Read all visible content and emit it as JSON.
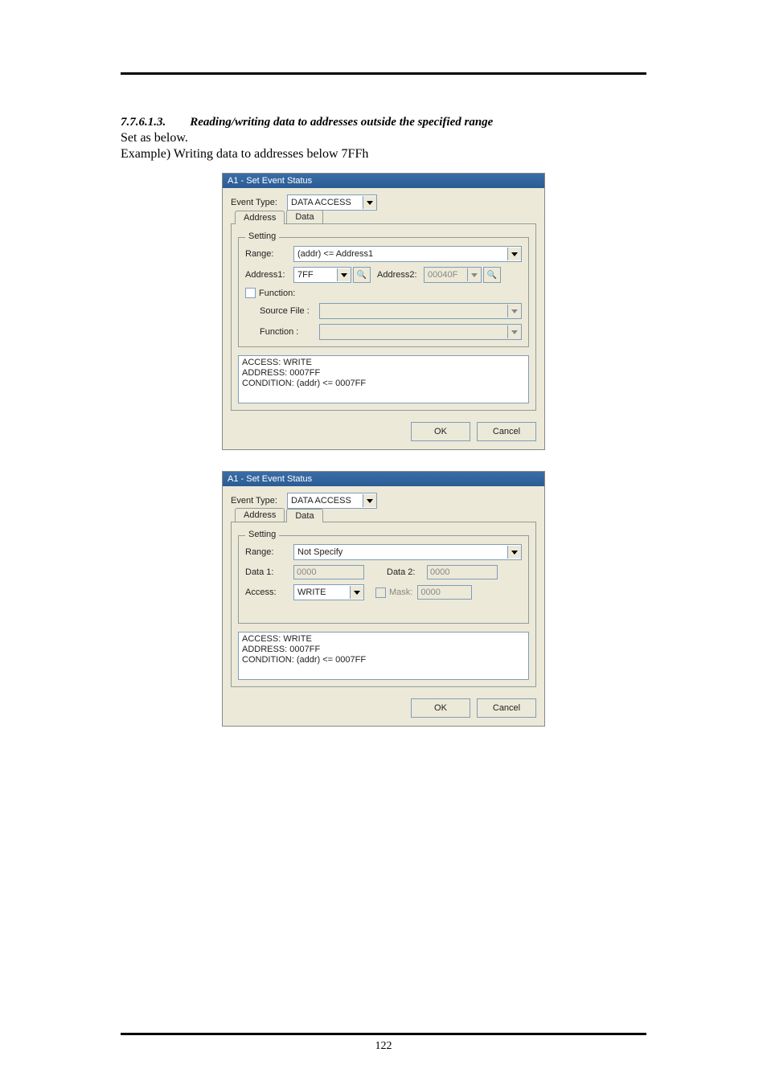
{
  "section": {
    "number": "7.7.6.1.3.",
    "title": "Reading/writing data to addresses outside the specified range"
  },
  "intro_line1": "Set as below.",
  "intro_line2": "Example) Writing data to addresses below 7FFh",
  "dlg1": {
    "title": "A1 - Set Event Status",
    "event_type_label": "Event Type:",
    "event_type_value": "DATA ACCESS",
    "tab_address": "Address",
    "tab_data": "Data",
    "legend": "Setting",
    "range_label": "Range:",
    "range_value": "(addr) <= Address1",
    "addr1_label": "Address1:",
    "addr1_value": "7FF",
    "addr2_label": "Address2:",
    "addr2_value": "00040F",
    "function_cb": "Function:",
    "source_file_label": "Source File :",
    "function_label": "Function :",
    "summary": "ACCESS: WRITE\nADDRESS: 0007FF\nCONDITION: (addr) <= 0007FF",
    "ok": "OK",
    "cancel": "Cancel"
  },
  "dlg2": {
    "title": "A1 - Set Event Status",
    "event_type_label": "Event Type:",
    "event_type_value": "DATA ACCESS",
    "tab_address": "Address",
    "tab_data": "Data",
    "legend": "Setting",
    "range_label": "Range:",
    "range_value": "Not Specify",
    "data1_label": "Data 1:",
    "data1_value": "0000",
    "data2_label": "Data 2:",
    "data2_value": "0000",
    "access_label": "Access:",
    "access_value": "WRITE",
    "mask_label": "Mask:",
    "mask_value": "0000",
    "summary": "ACCESS: WRITE\nADDRESS: 0007FF\nCONDITION: (addr) <= 0007FF",
    "ok": "OK",
    "cancel": "Cancel"
  },
  "page_number": "122"
}
